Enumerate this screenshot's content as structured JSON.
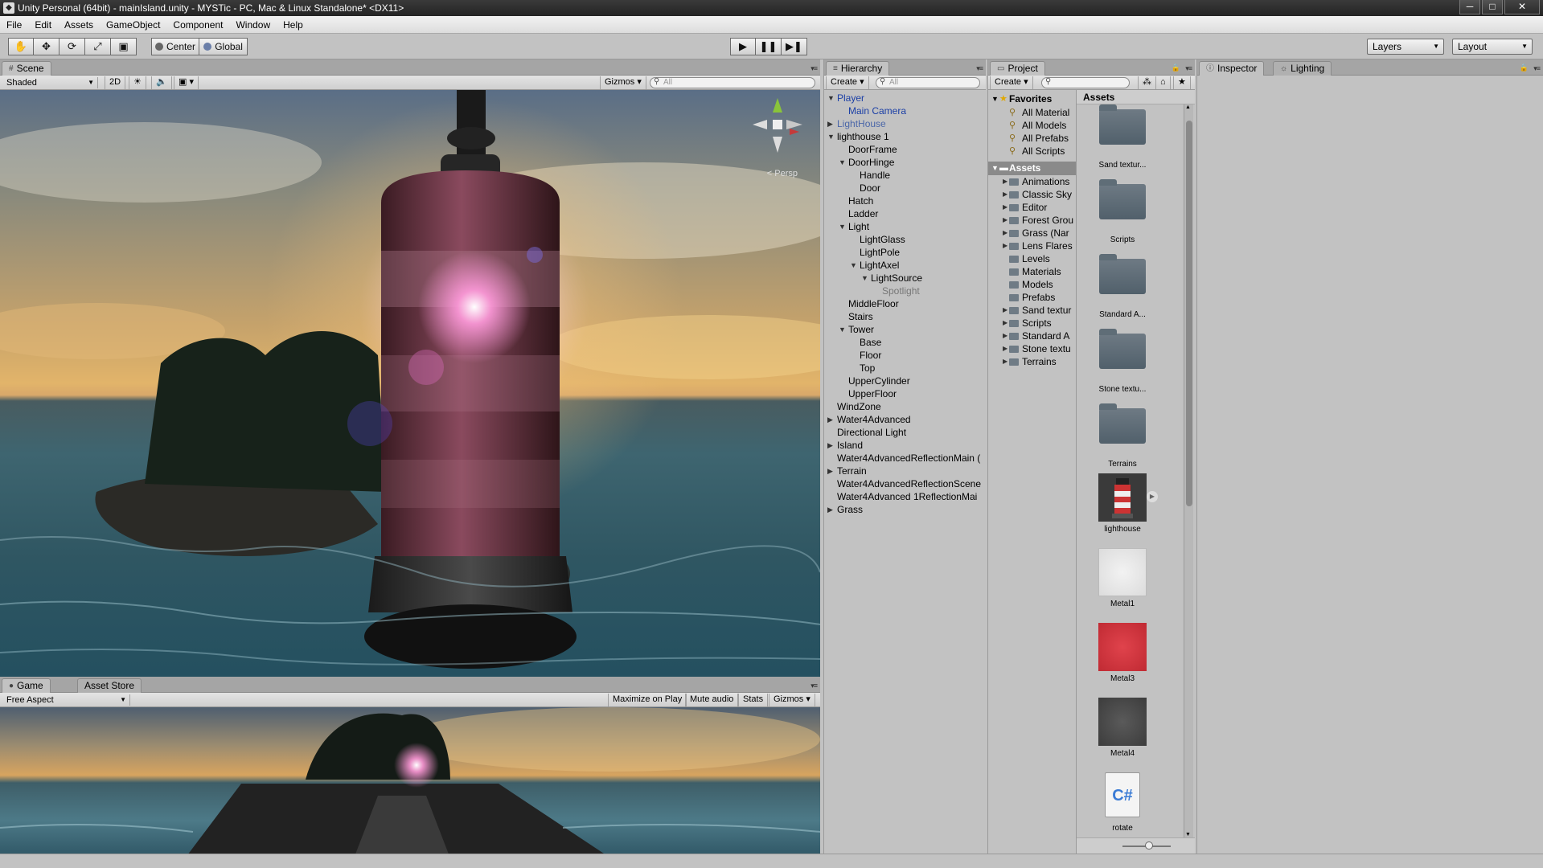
{
  "window": {
    "title": "Unity Personal (64bit) - mainIsland.unity - MYSTic - PC, Mac & Linux Standalone* <DX11>",
    "buttons": [
      "─",
      "□",
      "✕"
    ]
  },
  "menu": [
    "File",
    "Edit",
    "Assets",
    "GameObject",
    "Component",
    "Window",
    "Help"
  ],
  "toolbar": {
    "pivot_label": "Center",
    "space_label": "Global",
    "layers_label": "Layers",
    "layout_label": "Layout",
    "tool_icons": [
      "hand-icon",
      "move-icon",
      "rotate-icon",
      "scale-icon",
      "rect-icon"
    ],
    "play_icons": [
      "play-icon",
      "pause-icon",
      "step-icon"
    ]
  },
  "scene": {
    "tab_label": "Scene",
    "shading_mode": "Shaded",
    "mode_2d": "2D",
    "gizmos_label": "Gizmos",
    "search_placeholder": "All",
    "persp_label": "Persp"
  },
  "game": {
    "tab_label": "Game",
    "asset_store_label": "Asset Store",
    "aspect": "Free Aspect",
    "buttons": [
      "Maximize on Play",
      "Mute audio",
      "Stats",
      "Gizmos"
    ]
  },
  "hierarchy": {
    "tab_label": "Hierarchy",
    "create_label": "Create",
    "search_placeholder": "All",
    "items": [
      {
        "label": "Player",
        "depth": 0,
        "arrow": "expanded",
        "style": "blue"
      },
      {
        "label": "Main Camera",
        "depth": 1,
        "arrow": "",
        "style": "blue"
      },
      {
        "label": "LightHouse",
        "depth": 0,
        "arrow": "collapsed",
        "style": "faded"
      },
      {
        "label": "lighthouse 1",
        "depth": 0,
        "arrow": "expanded",
        "style": ""
      },
      {
        "label": "DoorFrame",
        "depth": 1,
        "arrow": "",
        "style": ""
      },
      {
        "label": "DoorHinge",
        "depth": 1,
        "arrow": "expanded",
        "style": ""
      },
      {
        "label": "Handle",
        "depth": 2,
        "arrow": "",
        "style": ""
      },
      {
        "label": "Door",
        "depth": 2,
        "arrow": "",
        "style": ""
      },
      {
        "label": "Hatch",
        "depth": 1,
        "arrow": "",
        "style": ""
      },
      {
        "label": "Ladder",
        "depth": 1,
        "arrow": "",
        "style": ""
      },
      {
        "label": "Light",
        "depth": 1,
        "arrow": "expanded",
        "style": ""
      },
      {
        "label": "LightGlass",
        "depth": 2,
        "arrow": "",
        "style": ""
      },
      {
        "label": "LightPole",
        "depth": 2,
        "arrow": "",
        "style": ""
      },
      {
        "label": "LightAxel",
        "depth": 2,
        "arrow": "expanded",
        "style": ""
      },
      {
        "label": "LightSource",
        "depth": 3,
        "arrow": "expanded",
        "style": ""
      },
      {
        "label": "Spotlight",
        "depth": 4,
        "arrow": "",
        "style": "gray"
      },
      {
        "label": "MiddleFloor",
        "depth": 1,
        "arrow": "",
        "style": ""
      },
      {
        "label": "Stairs",
        "depth": 1,
        "arrow": "",
        "style": ""
      },
      {
        "label": "Tower",
        "depth": 1,
        "arrow": "expanded",
        "style": ""
      },
      {
        "label": "Base",
        "depth": 2,
        "arrow": "",
        "style": ""
      },
      {
        "label": "Floor",
        "depth": 2,
        "arrow": "",
        "style": ""
      },
      {
        "label": "Top",
        "depth": 2,
        "arrow": "",
        "style": ""
      },
      {
        "label": "UpperCylinder",
        "depth": 1,
        "arrow": "",
        "style": ""
      },
      {
        "label": "UpperFloor",
        "depth": 1,
        "arrow": "",
        "style": ""
      },
      {
        "label": "WindZone",
        "depth": 0,
        "arrow": "",
        "style": ""
      },
      {
        "label": "Water4Advanced",
        "depth": 0,
        "arrow": "collapsed",
        "style": ""
      },
      {
        "label": "Directional Light",
        "depth": 0,
        "arrow": "",
        "style": ""
      },
      {
        "label": "Island",
        "depth": 0,
        "arrow": "collapsed",
        "style": ""
      },
      {
        "label": "Water4AdvancedReflectionMain (",
        "depth": 0,
        "arrow": "",
        "style": ""
      },
      {
        "label": "Terrain",
        "depth": 0,
        "arrow": "collapsed",
        "style": ""
      },
      {
        "label": "Water4AdvancedReflectionScene",
        "depth": 0,
        "arrow": "",
        "style": ""
      },
      {
        "label": "Water4Advanced 1ReflectionMai",
        "depth": 0,
        "arrow": "",
        "style": ""
      },
      {
        "label": "Grass",
        "depth": 0,
        "arrow": "collapsed",
        "style": ""
      }
    ]
  },
  "project": {
    "tab_label": "Project",
    "create_label": "Create",
    "favorites_label": "Favorites",
    "favorites": [
      "All Material",
      "All Models",
      "All Prefabs",
      "All Scripts"
    ],
    "assets_label": "Assets",
    "folders": [
      {
        "label": "Animations",
        "expandable": true
      },
      {
        "label": "Classic Sky",
        "expandable": true
      },
      {
        "label": "Editor",
        "expandable": true
      },
      {
        "label": "Forest Grou",
        "expandable": true
      },
      {
        "label": "Grass (Nar",
        "expandable": true
      },
      {
        "label": "Lens Flares",
        "expandable": true
      },
      {
        "label": "Levels",
        "expandable": false
      },
      {
        "label": "Materials",
        "expandable": false
      },
      {
        "label": "Models",
        "expandable": false
      },
      {
        "label": "Prefabs",
        "expandable": false
      },
      {
        "label": "Sand textur",
        "expandable": true
      },
      {
        "label": "Scripts",
        "expandable": true
      },
      {
        "label": "Standard A",
        "expandable": true
      },
      {
        "label": "Stone textu",
        "expandable": true
      },
      {
        "label": "Terrains",
        "expandable": true
      }
    ],
    "breadcrumb": "Assets",
    "grid_items": [
      {
        "label": "Sand textur...",
        "kind": "folder"
      },
      {
        "label": "Scripts",
        "kind": "folder"
      },
      {
        "label": "Standard A...",
        "kind": "folder"
      },
      {
        "label": "Stone textu...",
        "kind": "folder"
      },
      {
        "label": "Terrains",
        "kind": "folder"
      },
      {
        "label": "lighthouse",
        "kind": "model"
      },
      {
        "label": "Metal1",
        "kind": "material-white"
      },
      {
        "label": "Metal3",
        "kind": "material-red"
      },
      {
        "label": "Metal4",
        "kind": "material-dark"
      },
      {
        "label": "rotate",
        "kind": "script"
      }
    ],
    "script_glyph": "C#"
  },
  "inspector": {
    "tab_label": "Inspector",
    "lighting_label": "Lighting"
  }
}
